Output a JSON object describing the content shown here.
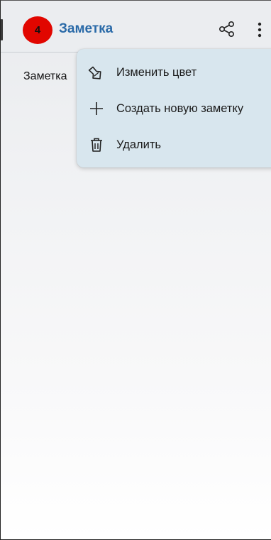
{
  "header": {
    "badge_count": "4",
    "title": "Заметка",
    "share_icon": "share-icon",
    "more_icon": "more-vertical-icon"
  },
  "note": {
    "body_text": "Заметка"
  },
  "menu": {
    "items": [
      {
        "label": "Изменить цвет",
        "icon": "paint-brush-icon"
      },
      {
        "label": "Создать новую заметку",
        "icon": "plus-icon"
      },
      {
        "label": "Удалить",
        "icon": "trash-icon"
      }
    ]
  },
  "colors": {
    "badge": "#e10600",
    "title": "#2a6aa8",
    "menu_background": "#d8e6ee",
    "topbar": "#ebedf0"
  }
}
